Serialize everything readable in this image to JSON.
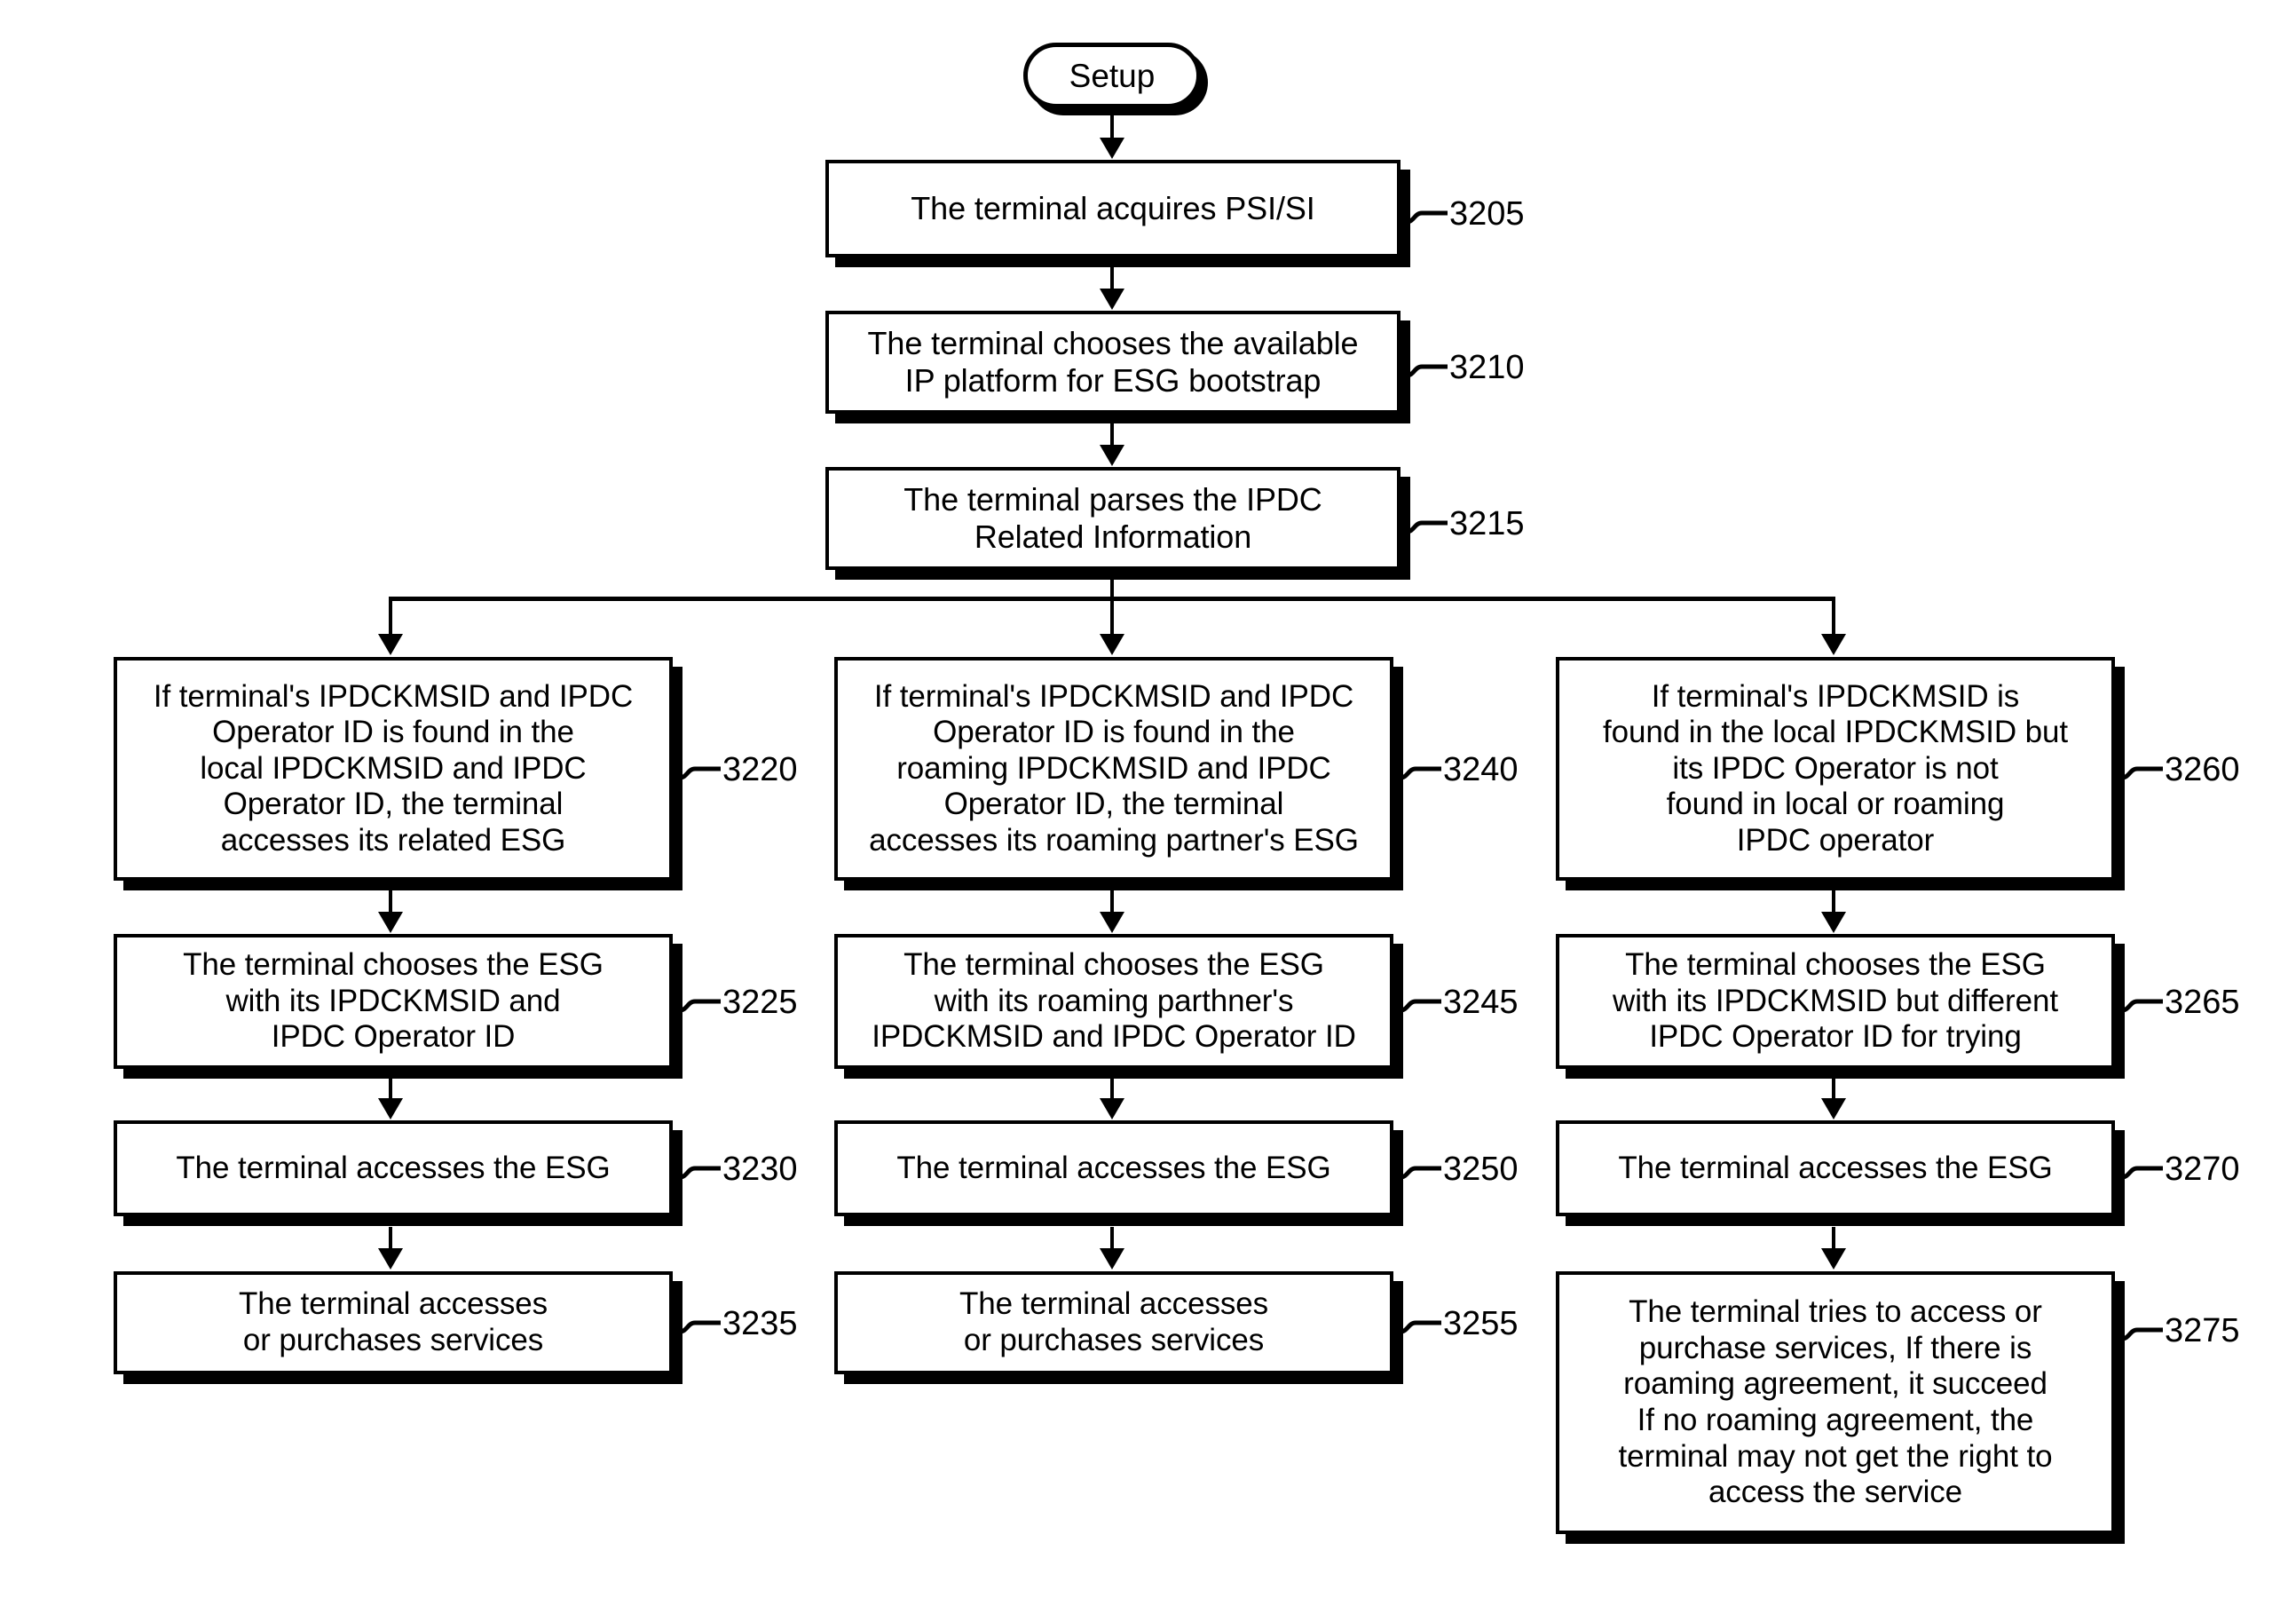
{
  "figure": {
    "type": "patent-flowchart",
    "start": {
      "label": "Setup"
    },
    "nodes": [
      {
        "id": "n3205",
        "ref": "3205",
        "text": "The terminal acquires PSI/SI",
        "column": "center",
        "row": 1
      },
      {
        "id": "n3210",
        "ref": "3210",
        "text": "The terminal chooses the available\nIP platform for ESG bootstrap",
        "column": "center",
        "row": 2
      },
      {
        "id": "n3215",
        "ref": "3215",
        "text": "The terminal parses the IPDC\nRelated Information",
        "column": "center",
        "row": 3
      },
      {
        "id": "n3220",
        "ref": "3220",
        "text": "If terminal's IPDCKMSID and IPDC\nOperator ID is found in the\nlocal IPDCKMSID and IPDC\nOperator ID, the terminal\naccesses its related ESG",
        "column": "left",
        "row": 4
      },
      {
        "id": "n3240",
        "ref": "3240",
        "text": "If terminal's IPDCKMSID and IPDC\nOperator ID is found in the\nroaming IPDCKMSID and IPDC\nOperator ID, the terminal\naccesses its roaming partner's ESG",
        "column": "center",
        "row": 4
      },
      {
        "id": "n3260",
        "ref": "3260",
        "text": "If terminal's IPDCKMSID is\nfound in the local IPDCKMSID but\nits IPDC Operator is not\nfound in local or roaming\nIPDC operator",
        "column": "right",
        "row": 4
      },
      {
        "id": "n3225",
        "ref": "3225",
        "text": "The terminal chooses the ESG\nwith its IPDCKMSID and\nIPDC Operator ID",
        "column": "left",
        "row": 5
      },
      {
        "id": "n3245",
        "ref": "3245",
        "text": "The terminal chooses the ESG\nwith its roaming parthner's\nIPDCKMSID and IPDC Operator ID",
        "column": "center",
        "row": 5
      },
      {
        "id": "n3265",
        "ref": "3265",
        "text": "The terminal chooses the ESG\nwith its IPDCKMSID but different\nIPDC Operator ID for trying",
        "column": "right",
        "row": 5
      },
      {
        "id": "n3230",
        "ref": "3230",
        "text": "The terminal accesses the ESG",
        "column": "left",
        "row": 6
      },
      {
        "id": "n3250",
        "ref": "3250",
        "text": "The terminal accesses the ESG",
        "column": "center",
        "row": 6
      },
      {
        "id": "n3270",
        "ref": "3270",
        "text": "The terminal accesses the ESG",
        "column": "right",
        "row": 6
      },
      {
        "id": "n3235",
        "ref": "3235",
        "text": "The terminal accesses\nor purchases services",
        "column": "left",
        "row": 7
      },
      {
        "id": "n3255",
        "ref": "3255",
        "text": "The terminal accesses\nor purchases services",
        "column": "center",
        "row": 7
      },
      {
        "id": "n3275",
        "ref": "3275",
        "text": "The terminal tries to access or\npurchase services, If there is\nroaming agreement, it succeed\nIf no roaming agreement, the\nterminal may not get the right to\naccess the service",
        "column": "right",
        "row": 7
      }
    ]
  }
}
